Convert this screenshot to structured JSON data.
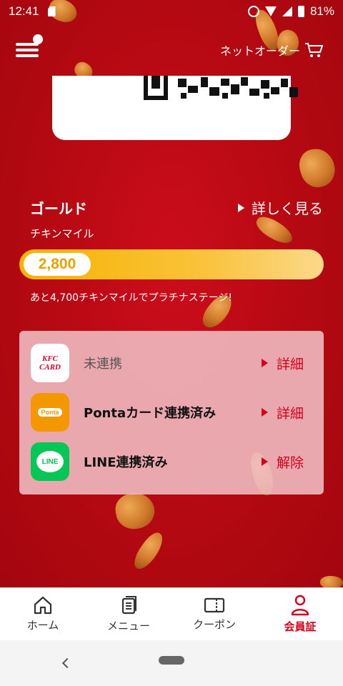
{
  "status_bar": {
    "time": "12:41",
    "battery": "81%"
  },
  "header": {
    "net_order_label": "ネットオーダー",
    "menu_has_badge": true
  },
  "member": {
    "rank": "ゴールド",
    "detail_link": "詳しく見る",
    "mile_label": "チキンマイル",
    "miles": "2,800",
    "progress_fraction": 0.37,
    "next_stage_text": "あと4,700チキンマイルでプラチナステージ!"
  },
  "links": [
    {
      "service": "KFC CARD",
      "logo_text_1": "KFC",
      "logo_text_2": "CARD",
      "status": "未連携",
      "action": "詳細"
    },
    {
      "service": "Ponta",
      "logo_text": "Ponta",
      "status": "Pontaカード連携済み",
      "action": "詳細"
    },
    {
      "service": "LINE",
      "logo_text": "LINE",
      "status": "LINE連携済み",
      "action": "解除"
    }
  ],
  "nav": [
    {
      "label": "ホーム",
      "icon": "home-icon",
      "active": false
    },
    {
      "label": "メニュー",
      "icon": "menu-book-icon",
      "active": false
    },
    {
      "label": "クーポン",
      "icon": "coupon-icon",
      "active": false
    },
    {
      "label": "会員証",
      "icon": "member-icon",
      "active": true
    }
  ],
  "colors": {
    "brand_red": "#c80d19",
    "accent_red": "#d6001c",
    "gold": "#f7b300"
  }
}
